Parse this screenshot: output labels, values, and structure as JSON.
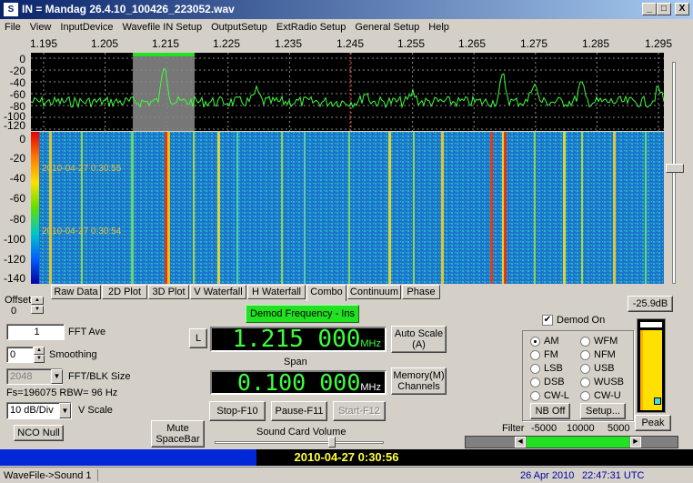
{
  "window": {
    "title": "IN = Mandag 26.4.10_100426_223052.wav",
    "icon": "sdr-app-icon",
    "controls": [
      "_",
      "□",
      "X"
    ]
  },
  "menu": [
    "File",
    "View",
    "InputDevice",
    "Wavefile IN Setup",
    "OutputSetup",
    "ExtRadio Setup",
    "General Setup",
    "Help"
  ],
  "freq_scale": [
    "1.195",
    "1.205",
    "1.215",
    "1.225",
    "1.235",
    "1.245",
    "1.255",
    "1.265",
    "1.275",
    "1.285",
    "1.295"
  ],
  "spectrum_y_labels": [
    "0",
    "-20",
    "-40",
    "-60",
    "-80",
    "-100",
    "-120"
  ],
  "waterfall_y_labels": [
    "0",
    "-20",
    "-40",
    "-60",
    "-80",
    "-100",
    "-120",
    "-140"
  ],
  "waterfall_timestamps": [
    "2010-04-27 0:30:55",
    "2010-04-27 0:30:54"
  ],
  "tabs": [
    "Raw Data",
    "2D Plot",
    "3D Plot",
    "V Waterfall",
    "H Waterfall",
    "Combo",
    "Continuum",
    "Phase"
  ],
  "active_tab": "Combo",
  "offset": {
    "label": "Offset",
    "value": "0"
  },
  "fft_ave": {
    "value": "1",
    "label": "FFT Ave"
  },
  "smoothing": {
    "value": "0",
    "label": "Smoothing"
  },
  "fft_blk": {
    "value": "2048",
    "label": "FFT/BLK Size"
  },
  "fs_info": "Fs=196075 RBW= 96 Hz",
  "vscale": {
    "value": "10 dB/Div",
    "label": "V Scale"
  },
  "nco_null": "NCO Null",
  "mute": "Mute SpaceBar",
  "demod_freq_btn": "Demod Frequency - Ins",
  "l_button": "L",
  "freq_display": {
    "value": "1.215 000",
    "unit": "MHz"
  },
  "span": {
    "label": "Span",
    "value": "0.100 000",
    "unit": "MHz"
  },
  "auto_scale": "Auto Scale (A)",
  "memory": "Memory(M) Channels",
  "stop": "Stop-F10",
  "pause": "Pause-F11",
  "start": "Start-F12",
  "sound_card_volume": "Sound Card Volume",
  "level_readout": "-25.9dB",
  "demod_on": {
    "label": "Demod On",
    "checked": true
  },
  "modes": [
    {
      "label": "AM",
      "selected": true
    },
    {
      "label": "WFM",
      "selected": false
    },
    {
      "label": "FM",
      "selected": false
    },
    {
      "label": "NFM",
      "selected": false
    },
    {
      "label": "LSB",
      "selected": false
    },
    {
      "label": "USB",
      "selected": false
    },
    {
      "label": "DSB",
      "selected": false
    },
    {
      "label": "WUSB",
      "selected": false
    },
    {
      "label": "CW-L",
      "selected": false
    },
    {
      "label": "CW-U",
      "selected": false
    }
  ],
  "nb_off": "NB Off",
  "setup": "Setup...",
  "peak": "Peak",
  "filter": {
    "label": "Filter",
    "values": [
      "-5000",
      "10000",
      "5000"
    ]
  },
  "time_display": "2010-04-27 0:30:56",
  "playback_progress": 0.37,
  "status": {
    "left": "WaveFile->Sound 1",
    "date": "26 Apr 2010",
    "time": "22:47:31 UTC"
  },
  "colors": {
    "trace": "#3cff3c",
    "title_start": "#0a246a",
    "title_end": "#a6caf0",
    "waterfall_bg": "#1a6cc8",
    "time_text": "#ffff40",
    "progress": "#0028d8"
  }
}
